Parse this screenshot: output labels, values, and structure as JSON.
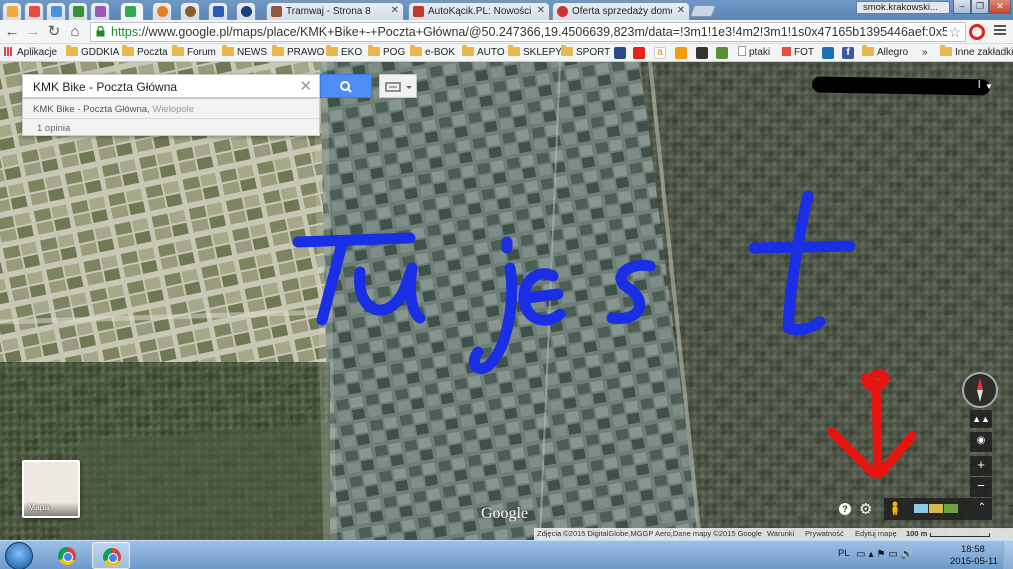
{
  "browser": {
    "tabs": [
      {
        "title": "",
        "favicon_color": "#f2a93b",
        "active": false
      },
      {
        "title": "",
        "favicon_color": "#e64c3c",
        "active": false
      },
      {
        "title": "",
        "favicon_color": "#4a90e2",
        "active": false
      },
      {
        "title": "",
        "favicon_color": "#3a8f3a",
        "active": false
      },
      {
        "title": "",
        "favicon_color": "#34a853",
        "active": true
      },
      {
        "title": "",
        "favicon_color": "#e67e22",
        "active": false
      },
      {
        "title": "",
        "favicon_color": "#8e5a2b",
        "active": false
      },
      {
        "title": "",
        "favicon_color": "#2a5db0",
        "active": false
      },
      {
        "title": "",
        "favicon_color": "#1c3f7a",
        "active": false
      },
      {
        "title": "Tramwaj - Strona 8",
        "favicon_color": "#8b5a3c",
        "active": false
      },
      {
        "title": "AutoKącik.PL: Nowości na",
        "favicon_color": "#c0392b",
        "active": false
      },
      {
        "title": "Oferta sprzedaży domeny",
        "favicon_color": "#d13232",
        "active": false
      }
    ],
    "profile_name": "smok.krakowski...",
    "url_scheme": "https",
    "url_rest": "://www.google.pl/maps/place/KMK+Bike+-+Poczta+Główna/@50.247366,19.4506639,823m/data=!3m1!1e3!4m2!3m1!1s0x47165b1395446aef:0x54a2a8c7"
  },
  "bookmarks": [
    {
      "label": "Aplikacje",
      "type": "apps"
    },
    {
      "label": "GDDKIA",
      "type": "folder"
    },
    {
      "label": "Poczta",
      "type": "folder"
    },
    {
      "label": "Forum",
      "type": "folder"
    },
    {
      "label": "NEWS",
      "type": "folder"
    },
    {
      "label": "PRAWO",
      "type": "folder"
    },
    {
      "label": "EKO",
      "type": "folder"
    },
    {
      "label": "POG",
      "type": "folder"
    },
    {
      "label": "e-BOK",
      "type": "folder"
    },
    {
      "label": "AUTO",
      "type": "folder"
    },
    {
      "label": "SKLEPY",
      "type": "folder"
    },
    {
      "label": "SPORT",
      "type": "folder"
    },
    {
      "label": "ptaki",
      "type": "page"
    },
    {
      "label": "FOT",
      "type": "page"
    },
    {
      "label": "Allegro",
      "type": "folder"
    },
    {
      "label": "»",
      "type": "more"
    },
    {
      "label": "Inne zakładki",
      "type": "folder"
    }
  ],
  "maps": {
    "search_value": "KMK Bike - Poczta Główna",
    "suggestion_main": "KMK Bike - Poczta Główna,",
    "suggestion_sub": " Wielopole",
    "reviews": "1 opinia",
    "account_letter": "l",
    "layer_label": "Mapa",
    "logo": "Google",
    "zoom_in": "+",
    "zoom_out": "−",
    "attribution": {
      "imagery": "Zdjęcia ©2015 DigitalGlobe,MGGP Aero,Dane mapy ©2015 Google",
      "terms": "Warunki",
      "privacy": "Prywatność",
      "edit": "Edytuj mapę",
      "scale": "100 m"
    },
    "annotation_text": "Tu jest",
    "annotation_color": "#1a2ee6",
    "arrow_color": "#e8130f"
  },
  "taskbar": {
    "language": "PL",
    "time": "18:58",
    "date": "2015-05-11"
  }
}
